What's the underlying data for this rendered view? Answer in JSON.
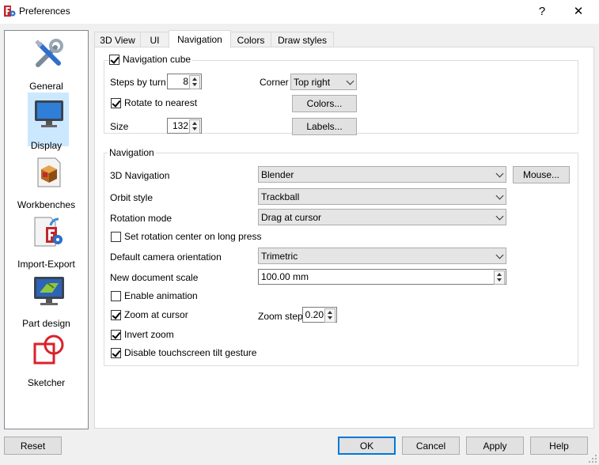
{
  "window": {
    "title": "Preferences",
    "help_glyph": "?",
    "close_glyph": "✕"
  },
  "sidebar": {
    "items": [
      {
        "label": "General",
        "icon": "tools-icon"
      },
      {
        "label": "Display",
        "icon": "monitor-icon",
        "selected": true
      },
      {
        "label": "Workbenches",
        "icon": "box-icon"
      },
      {
        "label": "Import-Export",
        "icon": "import-export-icon"
      },
      {
        "label": "Part design",
        "icon": "part-design-icon"
      },
      {
        "label": "Sketcher",
        "icon": "sketcher-icon"
      }
    ]
  },
  "tabs": [
    {
      "label": "3D View"
    },
    {
      "label": "UI"
    },
    {
      "label": "Navigation",
      "active": true
    },
    {
      "label": "Colors"
    },
    {
      "label": "Draw styles"
    }
  ],
  "nav_cube": {
    "group_label": "Navigation cube",
    "checked": true,
    "steps_label": "Steps by turn",
    "steps_value": "8",
    "corner_label": "Corner",
    "corner_value": "Top right",
    "rotate_label": "Rotate to nearest",
    "rotate_checked": true,
    "colors_button": "Colors...",
    "size_label": "Size",
    "size_value": "132",
    "labels_button": "Labels..."
  },
  "navigation": {
    "group_label": "Navigation",
    "nav3d_label": "3D Navigation",
    "nav3d_value": "Blender",
    "mouse_button": "Mouse...",
    "orbit_label": "Orbit style",
    "orbit_value": "Trackball",
    "rotation_label": "Rotation mode",
    "rotation_value": "Drag at cursor",
    "long_press_label": "Set rotation center on long press",
    "long_press_checked": false,
    "camera_label": "Default camera orientation",
    "camera_value": "Trimetric",
    "scale_label": "New document scale",
    "scale_value": "100.00 mm",
    "animation_label": "Enable animation",
    "animation_checked": false,
    "zoom_cursor_label": "Zoom at cursor",
    "zoom_cursor_checked": true,
    "zoom_step_label": "Zoom step",
    "zoom_step_value": "0.20",
    "invert_label": "Invert zoom",
    "invert_checked": true,
    "touch_label": "Disable touchscreen tilt gesture",
    "touch_checked": true
  },
  "footer": {
    "reset": "Reset",
    "ok": "OK",
    "cancel": "Cancel",
    "apply": "Apply",
    "help": "Help"
  }
}
